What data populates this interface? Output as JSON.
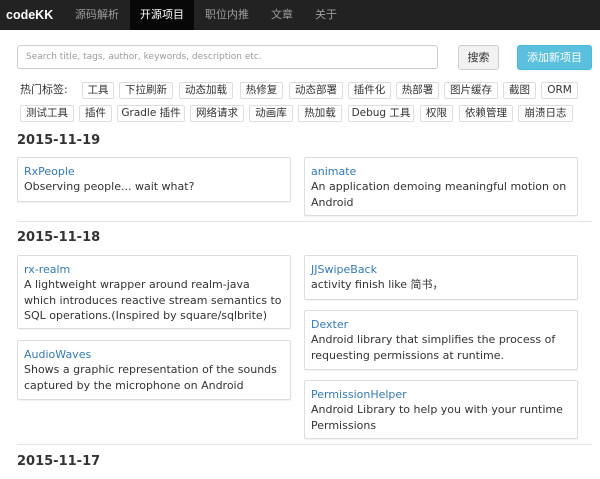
{
  "navbar": {
    "brand": "codeKK",
    "links": [
      {
        "label": "源码解析",
        "active": false
      },
      {
        "label": "开源项目",
        "active": true
      },
      {
        "label": "职位内推",
        "active": false
      },
      {
        "label": "文章",
        "active": false
      },
      {
        "label": "关于",
        "active": false
      }
    ]
  },
  "search": {
    "placeholder": "Search title, tags, author, keywords, description etc.",
    "value": "",
    "button_label": "搜索",
    "add_button_label": "添加新项目"
  },
  "tags": {
    "label": "热门标签:",
    "items": [
      "工具",
      "下拉刷新",
      "动态加载",
      "热修复",
      "动态部署",
      "插件化",
      "热部署",
      "图片缓存",
      "截图",
      "ORM",
      "测试工具",
      "插件",
      "Gradle 插件",
      "网络请求",
      "动画库",
      "热加载",
      "Debug 工具",
      "权限",
      "依赖管理",
      "崩溃日志"
    ]
  },
  "sections": [
    {
      "date": "2015-11-19",
      "projects": [
        {
          "name": "RxPeople",
          "description": "Observing people... wait what?"
        },
        {
          "name": "animate",
          "description": "An application demoing meaningful motion on Android"
        }
      ]
    },
    {
      "date": "2015-11-18",
      "projects": [
        {
          "name": "rx-realm",
          "description": "A lightweight wrapper around realm-java which introduces reactive stream semantics to SQL operations.(Inspired by square/sqlbrite)"
        },
        {
          "name": "JJSwipeBack",
          "description": "activity finish like 简书，"
        },
        {
          "name": "Dexter",
          "description": "Android library that simplifies the process of requesting permissions at runtime."
        },
        {
          "name": "AudioWaves",
          "description": "Shows a graphic representation of the sounds captured by the microphone on Android"
        },
        {
          "name": "PermissionHelper",
          "description": "Android Library to help you with your runtime Permissions"
        }
      ]
    },
    {
      "date": "2015-11-17",
      "projects": []
    }
  ],
  "colors": {
    "navbar_bg": "#222222",
    "link": "#337ab7",
    "info_button": "#5bc0de"
  }
}
